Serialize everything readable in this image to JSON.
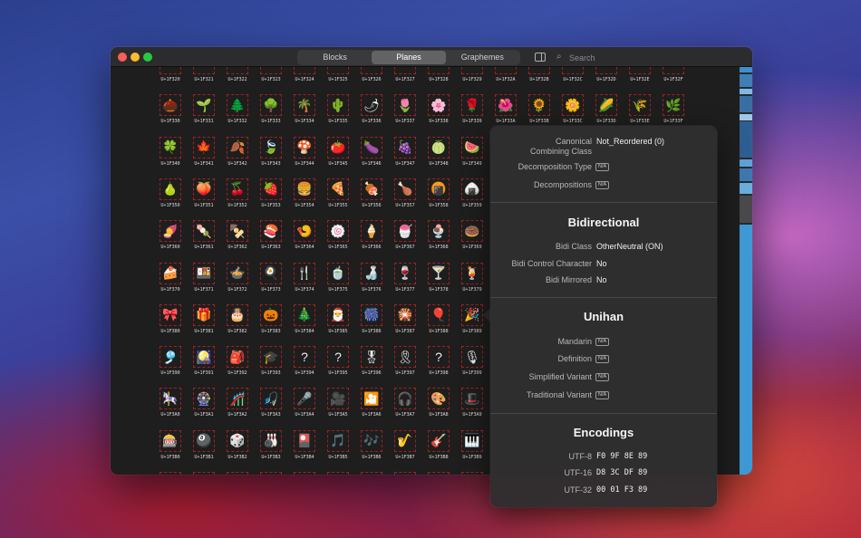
{
  "toolbar": {
    "tabs": [
      "Blocks",
      "Planes",
      "Graphemes"
    ],
    "active_tab": "Planes",
    "search_placeholder": "Search"
  },
  "grid": {
    "rows": [
      {
        "codes": [
          "U+1F320",
          "U+1F321",
          "U+1F322",
          "U+1F323",
          "U+1F324",
          "U+1F325",
          "U+1F326",
          "U+1F327",
          "U+1F328",
          "U+1F329",
          "U+1F32A",
          "U+1F32B",
          "U+1F32C",
          "U+1F32D",
          "U+1F32E",
          "U+1F32F"
        ],
        "glyphs": [
          "",
          "",
          "",
          "",
          "",
          "",
          "",
          "",
          "",
          "",
          "",
          "",
          "",
          "",
          "",
          ""
        ]
      },
      {
        "codes": [
          "U+1F330",
          "U+1F331",
          "U+1F332",
          "U+1F333",
          "U+1F334",
          "U+1F335",
          "U+1F336",
          "U+1F337",
          "U+1F338",
          "U+1F339",
          "U+1F33A",
          "U+1F33B",
          "U+1F33C",
          "U+1F33D",
          "U+1F33E",
          "U+1F33F"
        ],
        "glyphs": [
          "🌰",
          "🌱",
          "🌲",
          "🌳",
          "🌴",
          "🌵",
          "🌶",
          "🌷",
          "🌸",
          "🌹",
          "🌺",
          "🌻",
          "🌼",
          "🌽",
          "🌾",
          "🌿"
        ]
      },
      {
        "codes": [
          "U+1F340",
          "U+1F341",
          "U+1F342",
          "U+1F343",
          "U+1F344",
          "U+1F345",
          "U+1F346",
          "U+1F347",
          "U+1F348",
          "U+1F349"
        ],
        "glyphs": [
          "🍀",
          "🍁",
          "🍂",
          "🍃",
          "🍄",
          "🍅",
          "🍆",
          "🍇",
          "🍈",
          "🍉"
        ]
      },
      {
        "codes": [
          "U+1F350",
          "U+1F351",
          "U+1F352",
          "U+1F353",
          "U+1F354",
          "U+1F355",
          "U+1F356",
          "U+1F357",
          "U+1F358",
          "U+1F359"
        ],
        "glyphs": [
          "🍐",
          "🍑",
          "🍒",
          "🍓",
          "🍔",
          "🍕",
          "🍖",
          "🍗",
          "🍘",
          "🍙"
        ]
      },
      {
        "codes": [
          "U+1F360",
          "U+1F361",
          "U+1F362",
          "U+1F363",
          "U+1F364",
          "U+1F365",
          "U+1F366",
          "U+1F367",
          "U+1F368",
          "U+1F369"
        ],
        "glyphs": [
          "🍠",
          "🍡",
          "🍢",
          "🍣",
          "🍤",
          "🍥",
          "🍦",
          "🍧",
          "🍨",
          "🍩"
        ]
      },
      {
        "codes": [
          "U+1F370",
          "U+1F371",
          "U+1F372",
          "U+1F373",
          "U+1F374",
          "U+1F375",
          "U+1F376",
          "U+1F377",
          "U+1F378",
          "U+1F379"
        ],
        "glyphs": [
          "🍰",
          "🍱",
          "🍲",
          "🍳",
          "🍴",
          "🍵",
          "🍶",
          "🍷",
          "🍸",
          "🍹"
        ]
      },
      {
        "codes": [
          "U+1F380",
          "U+1F381",
          "U+1F382",
          "U+1F383",
          "U+1F384",
          "U+1F385",
          "U+1F386",
          "U+1F387",
          "U+1F388",
          "U+1F389"
        ],
        "glyphs": [
          "🎀",
          "🎁",
          "🎂",
          "🎃",
          "🎄",
          "🎅",
          "🎆",
          "🎇",
          "🎈",
          "🎉"
        ]
      },
      {
        "codes": [
          "U+1F390",
          "U+1F391",
          "U+1F392",
          "U+1F393",
          "U+1F394",
          "U+1F395",
          "U+1F396",
          "U+1F397",
          "U+1F398",
          "U+1F399"
        ],
        "glyphs": [
          "🎐",
          "🎑",
          "🎒",
          "🎓",
          "?",
          "?",
          "🎖",
          "🎗",
          "?",
          "🎙"
        ]
      },
      {
        "codes": [
          "U+1F3A0",
          "U+1F3A1",
          "U+1F3A2",
          "U+1F3A3",
          "U+1F3A4",
          "U+1F3A5",
          "U+1F3A6",
          "U+1F3A7",
          "U+1F3A8",
          "U+1F3A9"
        ],
        "glyphs": [
          "🎠",
          "🎡",
          "🎢",
          "🎣",
          "🎤",
          "🎥",
          "🎦",
          "🎧",
          "🎨",
          "🎩"
        ]
      },
      {
        "codes": [
          "U+1F3B0",
          "U+1F3B1",
          "U+1F3B2",
          "U+1F3B3",
          "U+1F3B4",
          "U+1F3B5",
          "U+1F3B6",
          "U+1F3B7",
          "U+1F3B8",
          "U+1F3B9"
        ],
        "glyphs": [
          "🎰",
          "🎱",
          "🎲",
          "🎳",
          "🎴",
          "🎵",
          "🎶",
          "🎷",
          "🎸",
          "🎹"
        ]
      },
      {
        "codes": [
          "",
          "",
          "",
          "",
          "",
          "",
          "",
          "",
          "",
          ""
        ],
        "glyphs": [
          "🎀",
          "🎀",
          "🎀",
          "🎀",
          "🎀",
          "🎀",
          "🎀",
          "🎀",
          "🎀",
          "🎀"
        ]
      }
    ]
  },
  "inspector": {
    "canonical_label": "Canonical Combining Class",
    "canonical_value": "Not_Reordered (0)",
    "decomp_type_label": "Decomposition Type",
    "decompositions_label": "Decompositions",
    "na": "N/A",
    "bidi_title": "Bidirectional",
    "bidi_class_label": "Bidi Class",
    "bidi_class_value": "OtherNeutral (ON)",
    "bidi_control_label": "Bidi Control Character",
    "bidi_control_value": "No",
    "bidi_mirrored_label": "Bidi Mirrored",
    "bidi_mirrored_value": "No",
    "unihan_title": "Unihan",
    "mandarin_label": "Mandarin",
    "definition_label": "Definition",
    "simplified_label": "Simplified Variant",
    "traditional_label": "Traditional Variant",
    "encodings_title": "Encodings",
    "utf8_label": "UTF-8",
    "utf8_value": "F0 9F 8E 89",
    "utf16_label": "UTF-16",
    "utf16_value": "D8 3C DF 89",
    "utf32_label": "UTF-32",
    "utf32_value": "00 01 F3 89"
  }
}
